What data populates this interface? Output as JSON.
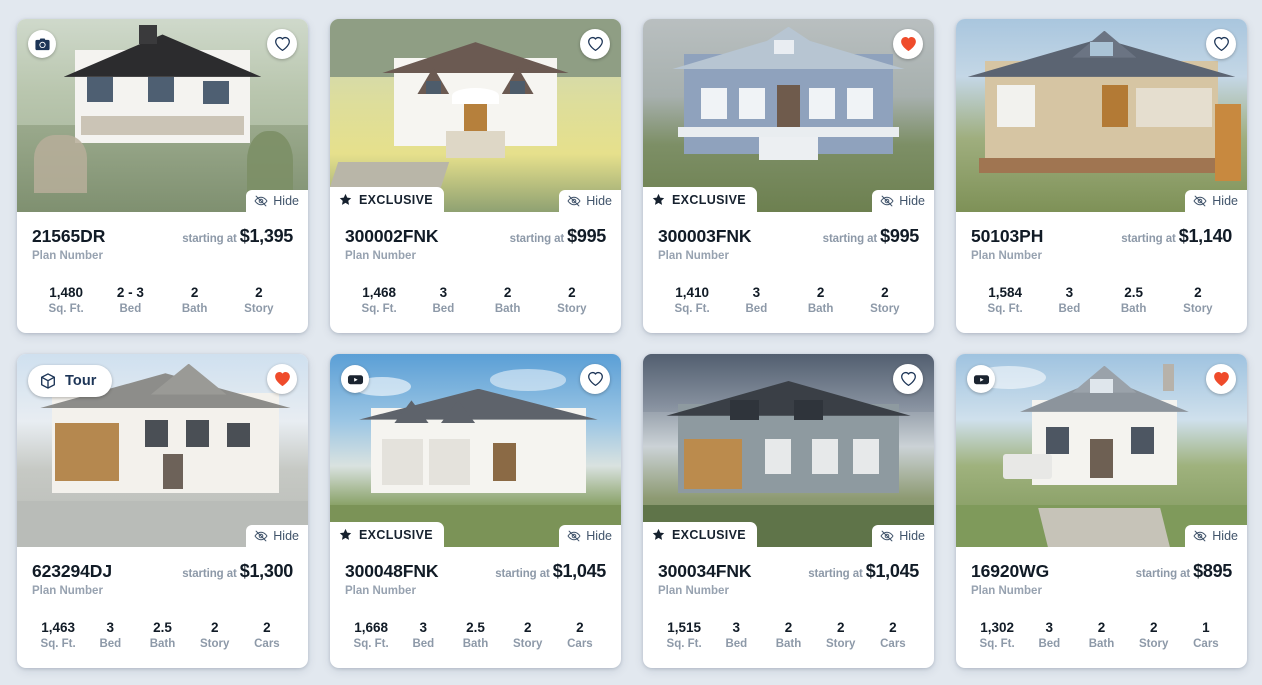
{
  "colors": {
    "page_background": "#e2e8ef",
    "card_background": "#ffffff",
    "favorite_active": "#ef4b2b",
    "text_primary": "#111b26",
    "text_muted": "#8d99a8",
    "tour_label": "#1d3557"
  },
  "labels": {
    "plan_number_sublabel": "Plan Number",
    "starting_at": "starting at",
    "hide": "Hide",
    "exclusive": "EXCLUSIVE",
    "tour": "Tour",
    "sqft": "Sq. Ft.",
    "bed": "Bed",
    "bath": "Bath",
    "story": "Story",
    "cars": "Cars"
  },
  "cards": [
    {
      "plan_number": "21565DR",
      "price": "$1,395",
      "media_icon": "camera-icon",
      "favorited": false,
      "exclusive": false,
      "hide": "Hide",
      "specs": [
        {
          "value": "1,480",
          "label": "Sq. Ft."
        },
        {
          "value": "2 - 3",
          "label": "Bed"
        },
        {
          "value": "2",
          "label": "Bath"
        },
        {
          "value": "2",
          "label": "Story"
        }
      ],
      "photo": "two-story-white-house-black-roof"
    },
    {
      "plan_number": "300002FNK",
      "price": "$995",
      "media_icon": null,
      "favorited": false,
      "exclusive": true,
      "hide": "Hide",
      "specs": [
        {
          "value": "1,468",
          "label": "Sq. Ft."
        },
        {
          "value": "3",
          "label": "Bed"
        },
        {
          "value": "2",
          "label": "Bath"
        },
        {
          "value": "2",
          "label": "Story"
        }
      ],
      "photo": "white-farmhouse-dormers-yellow-field"
    },
    {
      "plan_number": "300003FNK",
      "price": "$995",
      "media_icon": null,
      "favorited": true,
      "exclusive": true,
      "hide": "Hide",
      "specs": [
        {
          "value": "1,410",
          "label": "Sq. Ft."
        },
        {
          "value": "3",
          "label": "Bed"
        },
        {
          "value": "2",
          "label": "Bath"
        },
        {
          "value": "2",
          "label": "Story"
        }
      ],
      "photo": "blue-cottage-front-porch"
    },
    {
      "plan_number": "50103PH",
      "price": "$1,140",
      "media_icon": null,
      "favorited": false,
      "exclusive": false,
      "hide": "Hide",
      "specs": [
        {
          "value": "1,584",
          "label": "Sq. Ft."
        },
        {
          "value": "3",
          "label": "Bed"
        },
        {
          "value": "2.5",
          "label": "Bath"
        },
        {
          "value": "2",
          "label": "Story"
        }
      ],
      "photo": "tan-craftsman-bungalow-porch"
    },
    {
      "plan_number": "623294DJ",
      "price": "$1,300",
      "media_icon": "tour-icon",
      "favorited": true,
      "exclusive": false,
      "hide": "Hide",
      "specs": [
        {
          "value": "1,463",
          "label": "Sq. Ft."
        },
        {
          "value": "3",
          "label": "Bed"
        },
        {
          "value": "2.5",
          "label": "Bath"
        },
        {
          "value": "2",
          "label": "Story"
        },
        {
          "value": "2",
          "label": "Cars"
        }
      ],
      "photo": "modern-farmhouse-wood-garage"
    },
    {
      "plan_number": "300048FNK",
      "price": "$1,045",
      "media_icon": "video-icon",
      "favorited": false,
      "exclusive": true,
      "hide": "Hide",
      "specs": [
        {
          "value": "1,668",
          "label": "Sq. Ft."
        },
        {
          "value": "3",
          "label": "Bed"
        },
        {
          "value": "2.5",
          "label": "Bath"
        },
        {
          "value": "2",
          "label": "Story"
        },
        {
          "value": "2",
          "label": "Cars"
        }
      ],
      "photo": "white-colonial-two-car-garage-sunset"
    },
    {
      "plan_number": "300034FNK",
      "price": "$1,045",
      "media_icon": null,
      "favorited": false,
      "exclusive": true,
      "hide": "Hide",
      "specs": [
        {
          "value": "1,515",
          "label": "Sq. Ft."
        },
        {
          "value": "3",
          "label": "Bed"
        },
        {
          "value": "2",
          "label": "Bath"
        },
        {
          "value": "2",
          "label": "Story"
        },
        {
          "value": "2",
          "label": "Cars"
        }
      ],
      "photo": "gray-dutch-colonial-stormy-sky"
    },
    {
      "plan_number": "16920WG",
      "price": "$895",
      "media_icon": "video-icon",
      "favorited": true,
      "exclusive": false,
      "hide": "Hide",
      "specs": [
        {
          "value": "1,302",
          "label": "Sq. Ft."
        },
        {
          "value": "3",
          "label": "Bed"
        },
        {
          "value": "2",
          "label": "Bath"
        },
        {
          "value": "2",
          "label": "Story"
        },
        {
          "value": "1",
          "label": "Cars"
        }
      ],
      "photo": "white-farmhouse-driveway-truck"
    }
  ]
}
